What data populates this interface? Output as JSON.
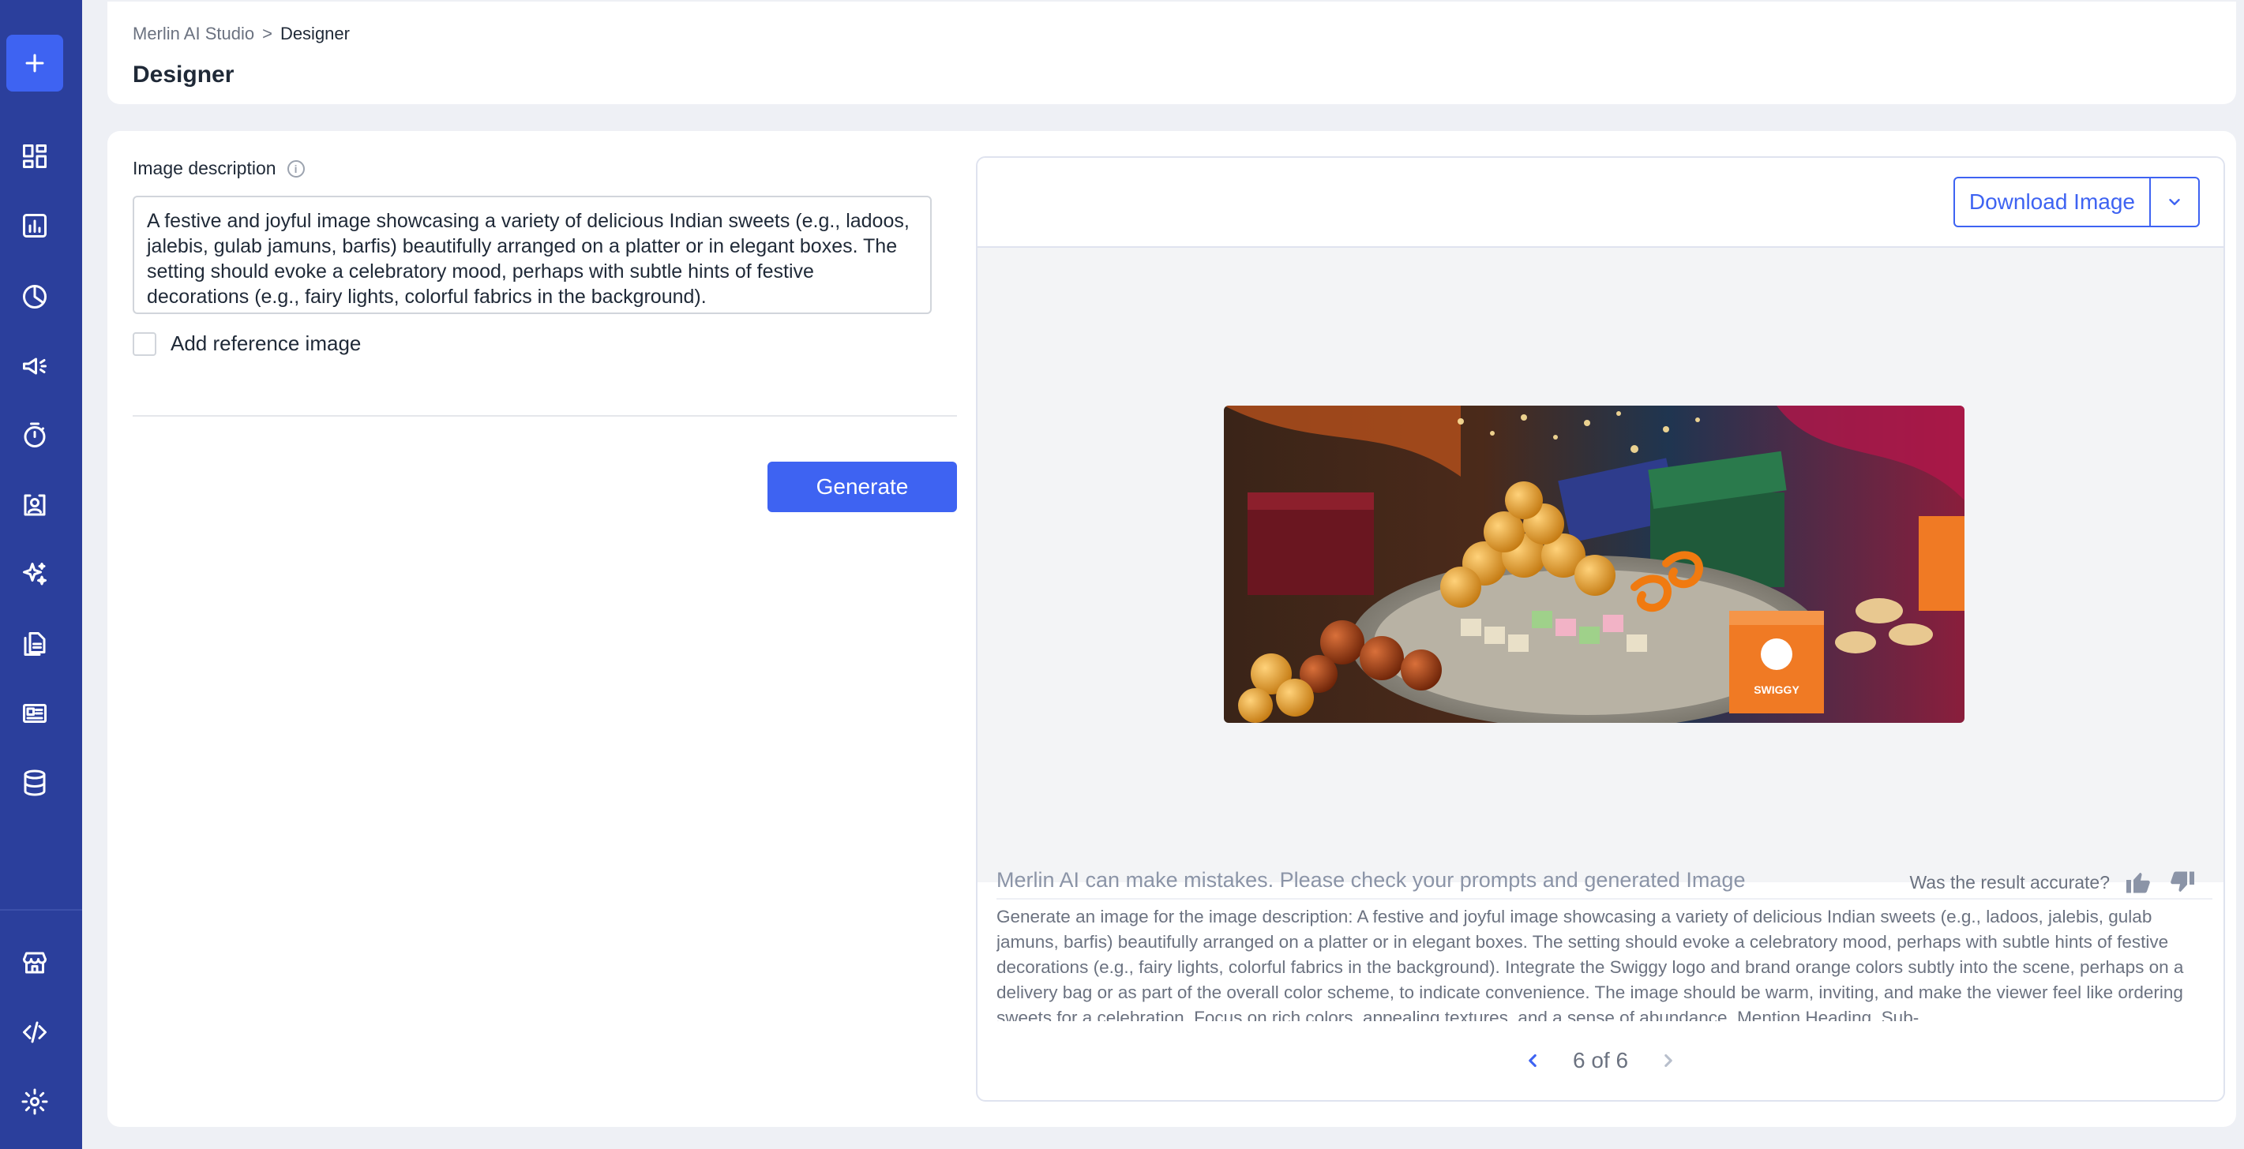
{
  "sidebar": {
    "new_icon": "plus-icon",
    "items": [
      {
        "name": "dashboard",
        "icon": "dashboard-grid-icon"
      },
      {
        "name": "analytics",
        "icon": "bar-chart-icon"
      },
      {
        "name": "segments",
        "icon": "pie-chart-icon"
      },
      {
        "name": "campaigns",
        "icon": "megaphone-icon"
      },
      {
        "name": "journeys",
        "icon": "stopwatch-icon"
      },
      {
        "name": "contacts",
        "icon": "user-card-icon"
      },
      {
        "name": "ai-studio",
        "icon": "sparkles-icon"
      },
      {
        "name": "templates",
        "icon": "copy-document-icon"
      },
      {
        "name": "content",
        "icon": "newspaper-icon"
      },
      {
        "name": "data",
        "icon": "database-icon"
      }
    ],
    "bottom_items": [
      {
        "name": "store",
        "icon": "storefront-icon"
      },
      {
        "name": "developer",
        "icon": "code-icon"
      },
      {
        "name": "settings",
        "icon": "gear-icon"
      }
    ]
  },
  "header": {
    "breadcrumb_root": "Merlin AI Studio",
    "breadcrumb_sep": ">",
    "breadcrumb_current": "Designer",
    "title": "Designer"
  },
  "form": {
    "description_label": "Image description",
    "description_value": "A festive and joyful image showcasing a variety of delicious Indian sweets (e.g., ladoos, jalebis, gulab jamuns, barfis) beautifully arranged on a platter or in elegant boxes. The setting should evoke a celebratory mood, perhaps with subtle hints of festive decorations (e.g., fairy lights, colorful fabrics in the background).",
    "reference_label": "Add reference image",
    "reference_checked": false,
    "generate_label": "Generate"
  },
  "result": {
    "download_label": "Download Image",
    "image_badge_text": "SWIGGY",
    "disclaimer": "Merlin AI can make mistakes. Please check your prompts and generated Image",
    "feedback_question": "Was the result accurate?",
    "prompt_text": "Generate an image for the image description: A festive and joyful image showcasing a variety of delicious Indian sweets (e.g., ladoos, jalebis, gulab jamuns, barfis) beautifully arranged on a platter or in elegant boxes. The setting should evoke a celebratory mood, perhaps with subtle hints of festive decorations (e.g., fairy lights, colorful fabrics in the background). Integrate the Swiggy logo and brand orange colors subtly into the scene, perhaps on a delivery bag or as part of the overall color scheme, to indicate convenience. The image should be warm, inviting, and make the viewer feel like ordering sweets for a celebration. Focus on rich colors, appealing textures, and a sense of abundance. Mention Heading, Sub-",
    "pagination": "6 of 6"
  },
  "colors": {
    "sidebar": "#2b3f9c",
    "accent": "#3e63f2",
    "page_bg": "#eef0f5"
  }
}
